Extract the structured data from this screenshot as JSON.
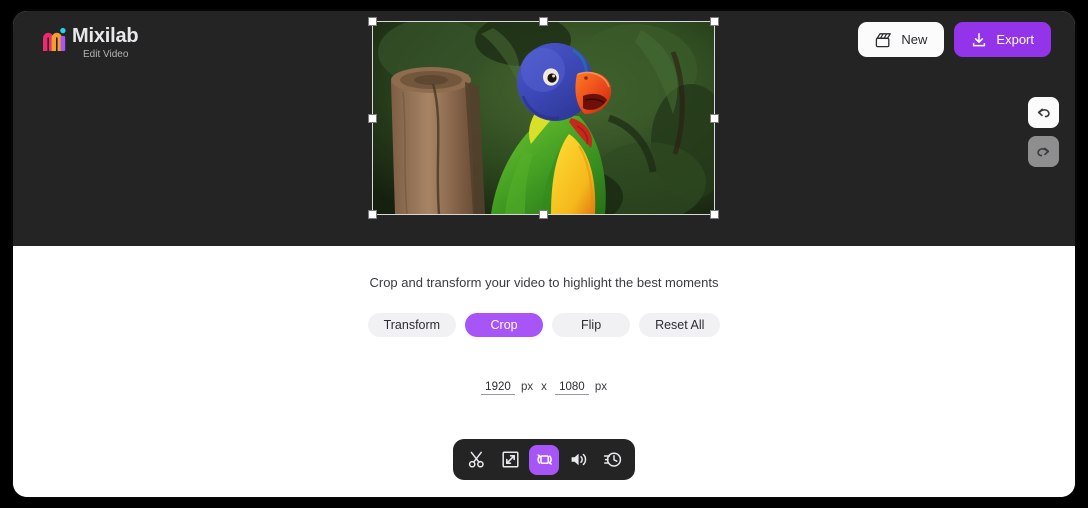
{
  "brand": {
    "name": "Mixilab",
    "subtitle": "Edit Video",
    "logo_icon": "mixilab-m-logo"
  },
  "colors": {
    "accent": "#9333ea",
    "accent_light": "#a855f7",
    "stage_bg": "#242424",
    "panel_bg": "#ffffff",
    "logo_pink": "#ec2a6e",
    "logo_orange": "#f59e2c",
    "logo_purple": "#a855f7",
    "logo_cyan": "#22d3ee",
    "undo_bg": "#fbfbfb",
    "redo_bg": "#8e8e8e"
  },
  "top_actions": [
    {
      "id": "new",
      "label": "New",
      "icon": "clapperboard-icon"
    },
    {
      "id": "export",
      "label": "Export",
      "icon": "download-icon"
    }
  ],
  "history": [
    {
      "id": "undo",
      "icon": "undo-arrow-icon",
      "enabled": true
    },
    {
      "id": "redo",
      "icon": "redo-arrow-icon",
      "enabled": false
    }
  ],
  "preview": {
    "media_type": "video",
    "media_description": "Rainbow lorikeet parrot perched on a wooden post with green foliage background",
    "selected": true,
    "handle_count": 8,
    "handles": [
      "top-left",
      "top-center",
      "top-right",
      "middle-left",
      "middle-right",
      "bottom-left",
      "bottom-center",
      "bottom-right"
    ]
  },
  "panel": {
    "hint": "Crop and transform your video to highlight the best moments",
    "tabs": [
      {
        "id": "transform",
        "label": "Transform",
        "active": false
      },
      {
        "id": "crop",
        "label": "Crop",
        "active": true
      },
      {
        "id": "flip",
        "label": "Flip",
        "active": false
      },
      {
        "id": "reset-all",
        "label": "Reset All",
        "active": false
      }
    ],
    "size": {
      "width_value": "1920",
      "height_value": "1080",
      "width_unit": "px",
      "height_unit": "px",
      "separator": "x"
    }
  },
  "tool_dock": [
    {
      "id": "cut",
      "icon": "scissors-icon",
      "active": false
    },
    {
      "id": "resize",
      "icon": "resize-diagonal-icon",
      "active": false
    },
    {
      "id": "transform",
      "icon": "rotate-transform-icon",
      "active": true
    },
    {
      "id": "volume",
      "icon": "speaker-volume-icon",
      "active": false
    },
    {
      "id": "speed",
      "icon": "clock-speed-icon",
      "active": false
    }
  ]
}
